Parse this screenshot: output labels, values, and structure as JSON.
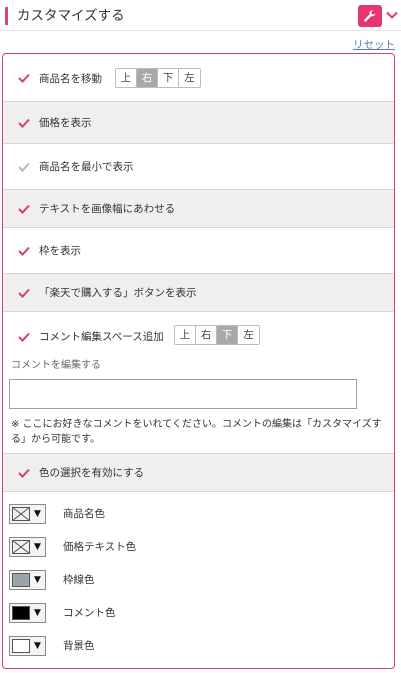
{
  "header": {
    "title": "カスタマイズする",
    "wrench_icon": "wrench-icon",
    "accent": "#e6356f"
  },
  "reset_label": "リセット",
  "options": [
    {
      "label": "商品名を移動",
      "checked": true
    },
    {
      "label": "価格を表示",
      "checked": true
    },
    {
      "label": "商品名を最小で表示",
      "checked": false
    },
    {
      "label": "テキストを画像幅にあわせる",
      "checked": true
    },
    {
      "label": "枠を表示",
      "checked": true
    },
    {
      "label": "「楽天で購入する」ボタンを表示",
      "checked": true
    },
    {
      "label": "コメント編集スペース追加",
      "checked": true
    },
    {
      "label": "色の選択を有効にする",
      "checked": true
    }
  ],
  "name_position": {
    "options": [
      "上",
      "右",
      "下",
      "左"
    ],
    "selected": "右"
  },
  "comment_position": {
    "options": [
      "上",
      "右",
      "下",
      "左"
    ],
    "selected": "下"
  },
  "comment": {
    "caption": "コメントを編集する",
    "value": "",
    "note": "※ ここにお好きなコメントをいれてください。コメントの編集は「カスタマイズする」から可能です。"
  },
  "colors": [
    {
      "label": "商品名色",
      "value": "none"
    },
    {
      "label": "価格テキスト色",
      "value": "none"
    },
    {
      "label": "枠線色",
      "value": "#9aa5aa"
    },
    {
      "label": "コメント色",
      "value": "#000000"
    },
    {
      "label": "背景色",
      "value": "#ffffff"
    }
  ],
  "check_color_on": "#d63d74",
  "check_color_off": "#b8b8b8"
}
